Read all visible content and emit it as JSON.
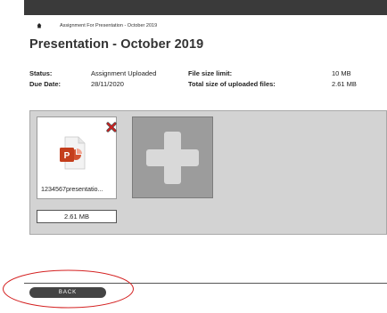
{
  "breadcrumb": {
    "current": "Assignment For Presentation - October 2019"
  },
  "page": {
    "title": "Presentation - October 2019"
  },
  "info": {
    "status_label": "Status:",
    "status_value": "Assignment Uploaded",
    "due_label": "Due Date:",
    "due_value": "28/11/2020",
    "limit_label": "File size limit:",
    "limit_value": "10 MB",
    "total_label": "Total size of uploaded files:",
    "total_value": "2.61 MB"
  },
  "files": [
    {
      "name": "1234567presentatio...",
      "size": "2.61 MB",
      "icon": "powerpoint-file-icon"
    }
  ],
  "actions": {
    "back_label": "BACK"
  },
  "colors": {
    "ppt_orange": "#d35230",
    "annotation_red": "#d42020",
    "topbar": "#3a3a3a"
  }
}
